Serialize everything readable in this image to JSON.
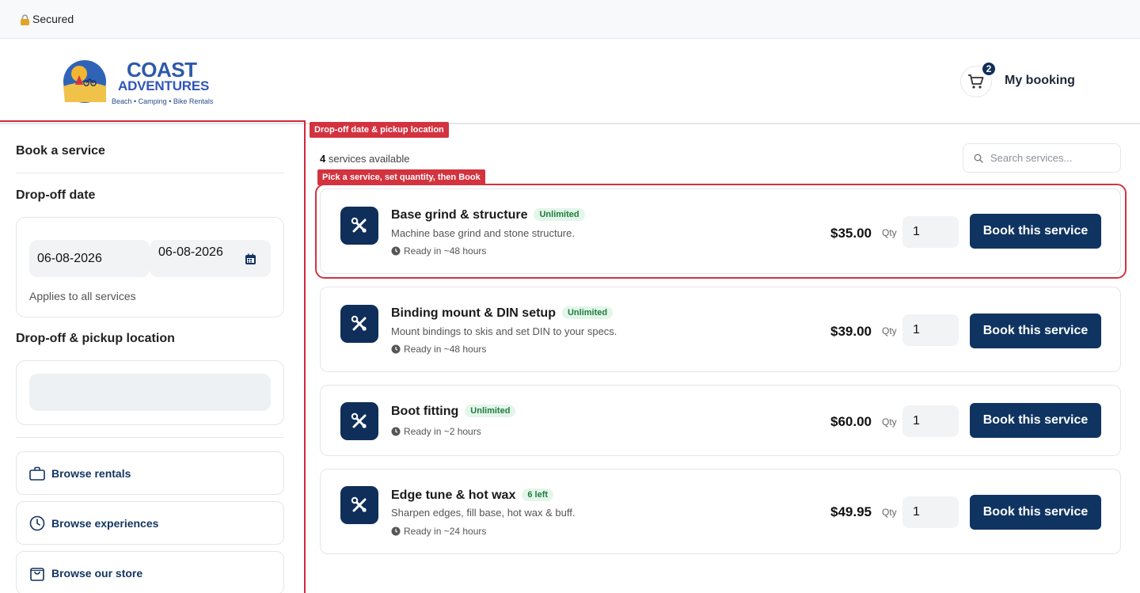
{
  "topbar": {
    "secure_label": "Secured",
    "lock_icon": "lock-icon"
  },
  "header": {
    "logo": {
      "main": "COAST",
      "sub": "ADVENTURES",
      "tagline": "Beach • Camping • Bike Rentals"
    },
    "cart_count": "2",
    "my_booking_label": "My booking"
  },
  "sidebar": {
    "title": "Book a service",
    "dropoff_date_label": "Drop-off date",
    "date_value_1": "06-08-2026",
    "date_value_2": "06-08-2026",
    "applies_note": "Applies to all services",
    "location_label": "Drop-off & pickup location",
    "location_value": "",
    "nav": [
      {
        "label": "Browse rentals",
        "icon": "briefcase-icon"
      },
      {
        "label": "Browse experiences",
        "icon": "clock-icon"
      },
      {
        "label": "Browse our store",
        "icon": "shopping-bag-icon"
      }
    ]
  },
  "annotations": {
    "location_tag": "Drop-off date & pickup location",
    "service_tag": "Pick a service, set quantity, then Book"
  },
  "main": {
    "count": "4",
    "count_suffix": " services available",
    "search_placeholder": "Search services...",
    "qty_label": "Qty",
    "book_label": "Book this service",
    "services": [
      {
        "name": "Base grind & structure",
        "badge": "Unlimited",
        "desc": "Machine base grind and stone structure.",
        "ready": "Ready in ~48 hours",
        "price": "$35.00",
        "qty": "1"
      },
      {
        "name": "Binding mount & DIN setup",
        "badge": "Unlimited",
        "desc": "Mount bindings to skis and set DIN to your specs.",
        "ready": "Ready in ~48 hours",
        "price": "$39.00",
        "qty": "1"
      },
      {
        "name": "Boot fitting",
        "badge": "Unlimited",
        "desc": "",
        "ready": "Ready in ~2 hours",
        "price": "$60.00",
        "qty": "1"
      },
      {
        "name": "Edge tune & hot wax",
        "badge": "6 left",
        "desc": "Sharpen edges, fill base, hot wax & buff.",
        "ready": "Ready in ~24 hours",
        "price": "$49.95",
        "qty": "1"
      }
    ]
  },
  "colors": {
    "brand_navy": "#0f3461",
    "accent_red": "#d3333f",
    "badge_green": "#1e7d3f"
  }
}
